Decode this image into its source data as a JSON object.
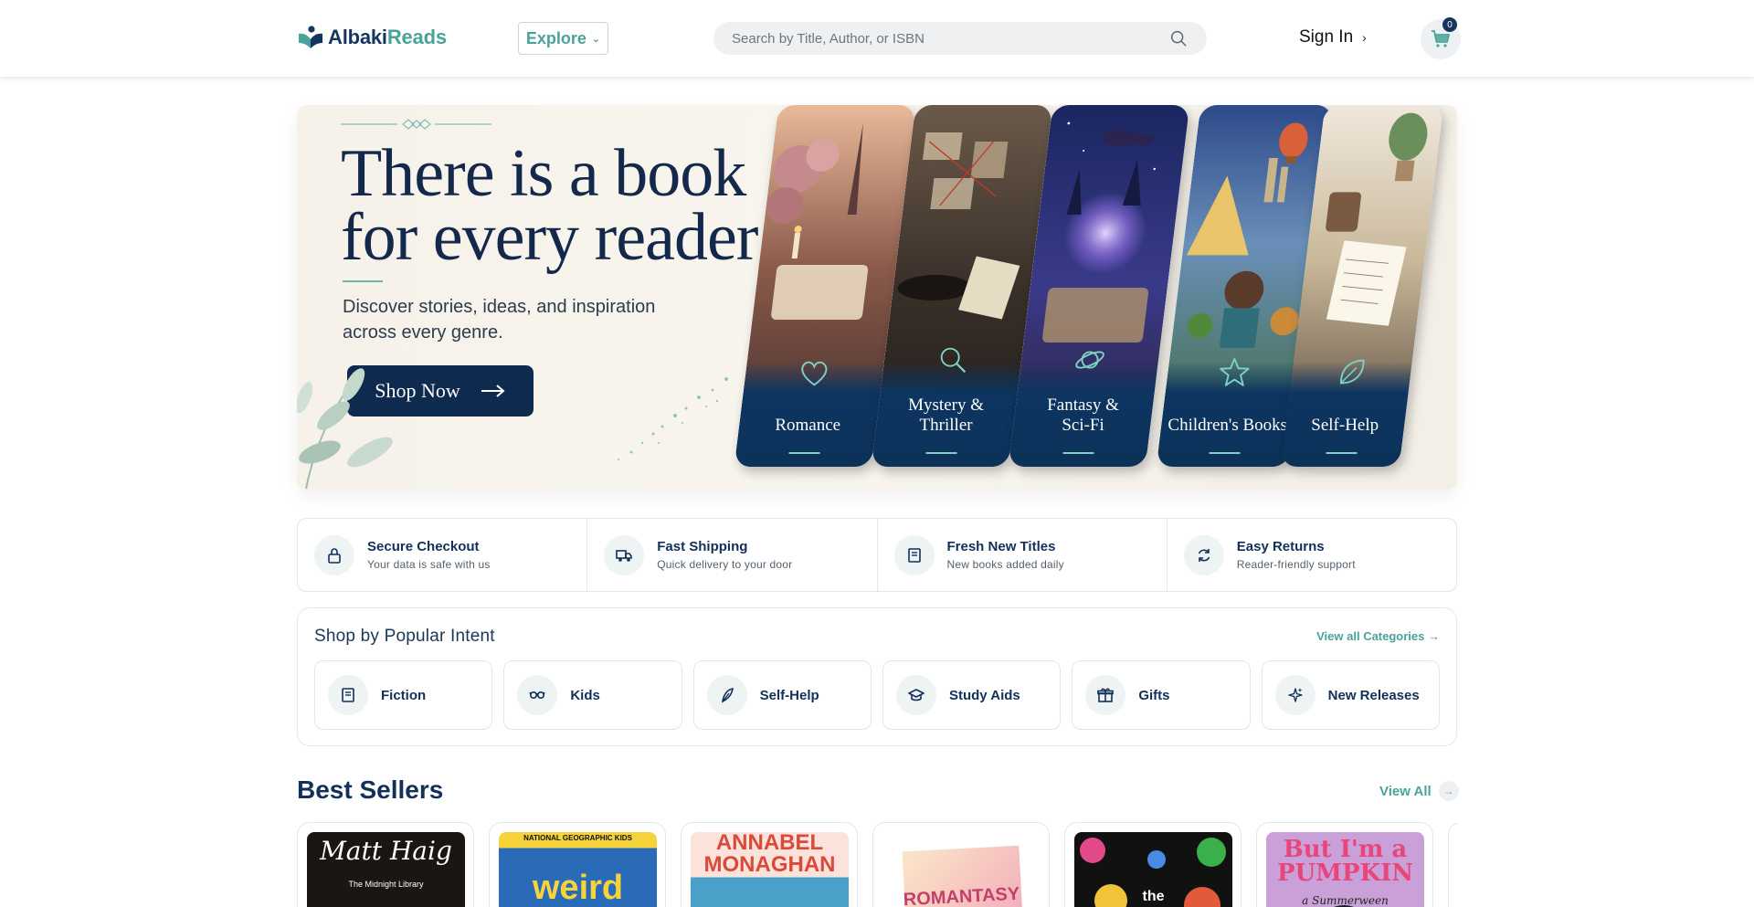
{
  "header": {
    "logo_part1": "Albaki",
    "logo_part2": "Reads",
    "explore_label": "Explore",
    "search_placeholder": "Search by Title, Author, or ISBN",
    "signin_label": "Sign In",
    "cart_count": "0"
  },
  "hero": {
    "title_line1": "There is a book",
    "title_line2": "for every reader",
    "subtitle_line1": "Discover stories, ideas, and inspiration",
    "subtitle_line2": "across every genre.",
    "button_label": "Shop Now",
    "categories": [
      {
        "line1": "Romance",
        "line2": "",
        "icon": "heart-icon"
      },
      {
        "line1": "Mystery &",
        "line2": "Thriller",
        "icon": "magnifier-icon"
      },
      {
        "line1": "Fantasy &",
        "line2": "Sci-Fi",
        "icon": "planet-icon"
      },
      {
        "line1": "Children's Books",
        "line2": "",
        "icon": "star-icon"
      },
      {
        "line1": "Self-Help",
        "line2": "",
        "icon": "leaf-icon"
      }
    ]
  },
  "features": [
    {
      "title": "Secure Checkout",
      "subtitle": "Your data is safe with us",
      "icon": "lock-icon"
    },
    {
      "title": "Fast Shipping",
      "subtitle": "Quick delivery to your door",
      "icon": "truck-icon"
    },
    {
      "title": "Fresh New Titles",
      "subtitle": "New books added daily",
      "icon": "book-icon"
    },
    {
      "title": "Easy Returns",
      "subtitle": "Reader-friendly support",
      "icon": "refresh-icon"
    }
  ],
  "intent": {
    "title": "Shop by Popular Intent",
    "link_label": "View all Categories →",
    "items": [
      {
        "label": "Fiction",
        "icon": "book-icon"
      },
      {
        "label": "Kids",
        "icon": "glasses-icon"
      },
      {
        "label": "Self-Help",
        "icon": "feather-icon"
      },
      {
        "label": "Study Aids",
        "icon": "graduation-cap-icon"
      },
      {
        "label": "Gifts",
        "icon": "gift-icon"
      },
      {
        "label": "New Releases",
        "icon": "sparkles-icon"
      }
    ]
  },
  "best_sellers": {
    "title": "Best Sellers",
    "link_label": "View All",
    "books": [
      {
        "cover_text": "Matt Haig",
        "cover_sub": "The Midnight Library"
      },
      {
        "cover_text": "weird",
        "cover_sub": "NATIONAL GEOGRAPHIC KIDS"
      },
      {
        "cover_text": "ANNABEL MONAGHAN",
        "cover_sub": ""
      },
      {
        "cover_text": "ROMANTASY",
        "cover_sub": ""
      },
      {
        "cover_text": "the",
        "cover_sub": ""
      },
      {
        "cover_text": "But I'm a PUMPKIN",
        "cover_sub": "a Summerween"
      }
    ]
  },
  "colors": {
    "navy": "#0f2a4f",
    "teal": "#4aa39a",
    "card_blue": "#0d3560"
  }
}
